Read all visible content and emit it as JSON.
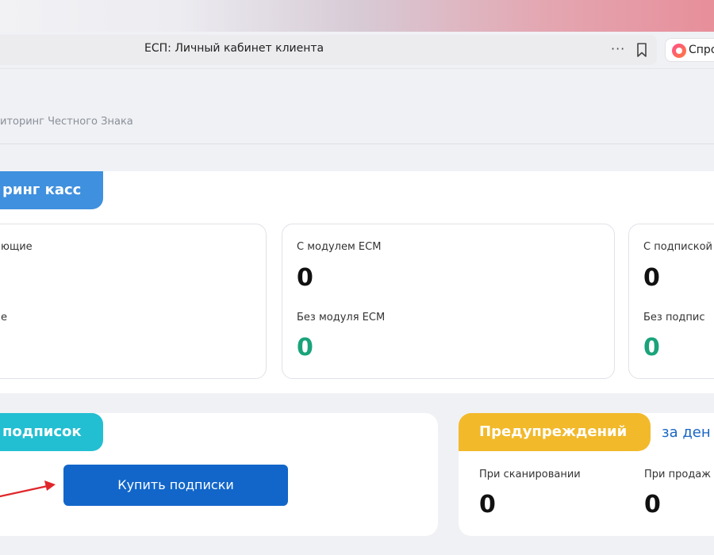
{
  "browser": {
    "page_title": "ЕСП: Личный кабинет клиента",
    "more": "···",
    "ask_label": "Спро"
  },
  "breadcrumb": "иторинг Честного Знака",
  "monitoring": {
    "tag": "ринг касс",
    "card_a": {
      "label_top": "ющие",
      "label_bottom": "е"
    },
    "card_b": {
      "label_top": "С модулем ECM",
      "value_top": "0",
      "label_bottom": "Без модуля ECM",
      "value_bottom": "0"
    },
    "card_c": {
      "label_top": "С подпиской",
      "value_top": "0",
      "label_bottom": "Без подпис",
      "value_bottom": "0"
    }
  },
  "subscriptions": {
    "tag": "подписок",
    "buy_button": "Купить подписки",
    "arrow_color": "#e0262b"
  },
  "warnings": {
    "tag": "Предупреждений",
    "period_link": "за ден",
    "scan_label": "При сканировании",
    "scan_value": "0",
    "sale_label": "При продаж",
    "sale_value": "0"
  },
  "colors": {
    "blue_tag": "#3f90de",
    "teal_tag": "#22bfd2",
    "yellow_tag": "#f2b92a",
    "button": "#1266c9",
    "green_value": "#1aa37a",
    "link": "#1a66c4"
  }
}
